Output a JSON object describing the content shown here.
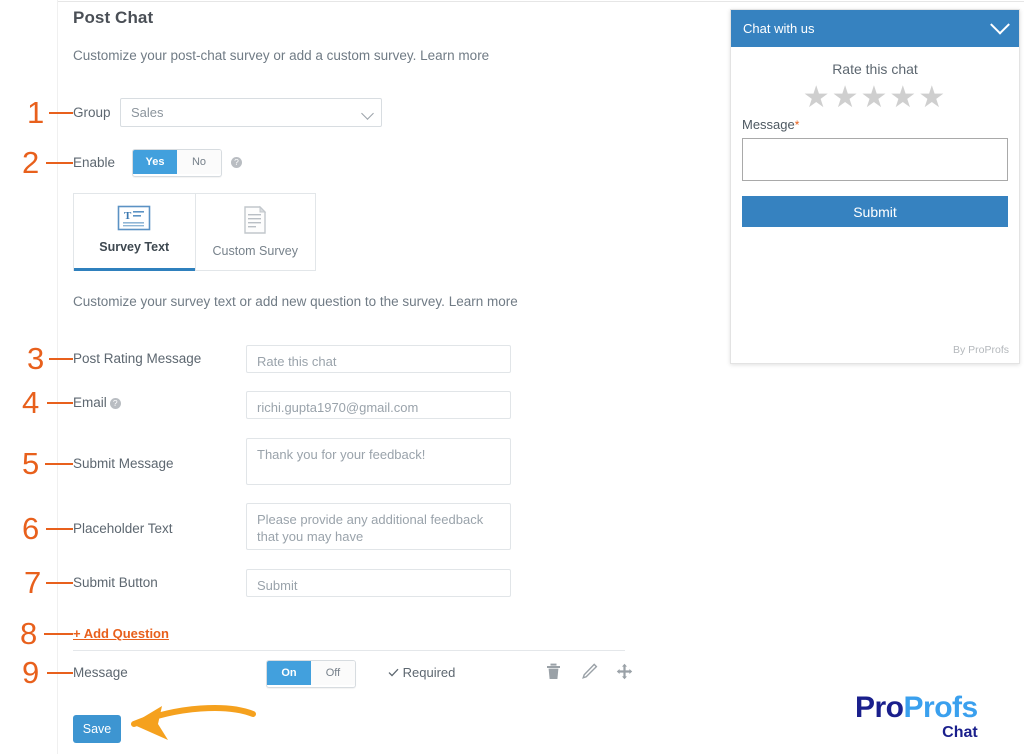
{
  "page": {
    "title": "Post Chat",
    "subtitle_text": "Customize your post-chat survey or add a custom survey.",
    "subtitle_link": "Learn more",
    "section_subtitle_text": "Customize your survey text or add new question to the survey.",
    "section_subtitle_link": "Learn more"
  },
  "annotations": {
    "n1": "1",
    "n2": "2",
    "n3": "3",
    "n4": "4",
    "n5": "5",
    "n6": "6",
    "n7": "7",
    "n8": "8",
    "n9": "9",
    "color": "#e8601c"
  },
  "form": {
    "group": {
      "label": "Group",
      "value": "Sales",
      "options": [
        "Sales"
      ]
    },
    "enable": {
      "label": "Enable",
      "yes_label": "Yes",
      "no_label": "No",
      "selected": "Yes"
    },
    "tabs": [
      {
        "label": "Survey Text",
        "active": true
      },
      {
        "label": "Custom Survey",
        "active": false
      }
    ],
    "fields": [
      {
        "label": "Post Rating Message",
        "value": "Rate this chat"
      },
      {
        "label": "Email",
        "value": "richi.gupta1970@gmail.com",
        "has_help": true
      },
      {
        "label": "Submit Message",
        "value": "Thank you for your feedback!"
      },
      {
        "label": "Placeholder Text",
        "value": "Please provide any additional feedback that you may have"
      },
      {
        "label": "Submit Button",
        "value": "Submit"
      }
    ],
    "add_question": "+ Add Question",
    "question_row": {
      "label": "Message",
      "on_label": "On",
      "off_label": "Off",
      "selected": "On",
      "required_label": "Required"
    },
    "save_label": "Save"
  },
  "widget": {
    "header_title": "Chat with us",
    "rate_title": "Rate this chat",
    "stars": 5,
    "star_glyph": "★",
    "message_label": "Message",
    "required_mark": "*",
    "textarea_value": "",
    "submit_label": "Submit",
    "footer": "By ProProfs"
  },
  "logo": {
    "part1": "Pro",
    "part2": "Profs",
    "part3": "Chat",
    "color1": "#1a1f8c",
    "color2": "#3aa0ee"
  },
  "colors": {
    "accent_blue": "#3682c0",
    "toggle_blue": "#42a0dd",
    "annotation_orange": "#e8601c",
    "arrow_orange": "#f5a11e"
  }
}
